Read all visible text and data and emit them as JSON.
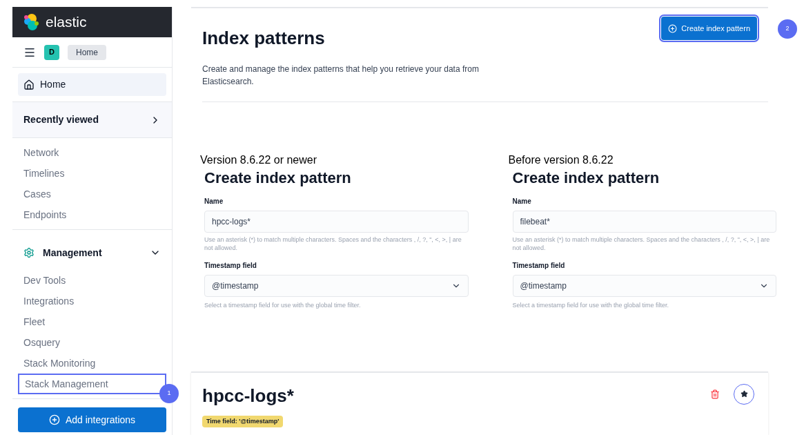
{
  "sidebar": {
    "logo": "elastic",
    "avatar": "D",
    "breadcrumb": "Home",
    "home": "Home",
    "recently_viewed": {
      "label": "Recently viewed",
      "expanded": false
    },
    "items": [
      {
        "label": "Network"
      },
      {
        "label": "Timelines"
      },
      {
        "label": "Cases"
      },
      {
        "label": "Endpoints"
      }
    ],
    "management": {
      "label": "Management",
      "expanded": true,
      "items": [
        {
          "label": "Dev Tools"
        },
        {
          "label": "Integrations"
        },
        {
          "label": "Fleet"
        },
        {
          "label": "Osquery"
        },
        {
          "label": "Stack Monitoring"
        },
        {
          "label": "Stack Management",
          "callout": "1"
        }
      ]
    },
    "add_button": "Add integrations"
  },
  "header": {
    "title": "Index patterns",
    "description": "Create and manage the index patterns that help you retrieve your data from Elasticsearch.",
    "create_button": {
      "label": "Create index pattern",
      "callout": "2"
    }
  },
  "versions": [
    {
      "caption": "Version 8.6.22 or newer",
      "title": "Create index pattern",
      "name_label": "Name",
      "name_value": "hpcc-logs*",
      "name_help": "Use an asterisk (*) to match multiple characters. Spaces and the characters , /, ?, \", <, >, | are not allowed.",
      "timestamp_label": "Timestamp field",
      "timestamp_value": "@timestamp",
      "timestamp_help": "Select a timestamp field for use with the global time filter."
    },
    {
      "caption": "Before version 8.6.22",
      "title": "Create index pattern",
      "name_label": "Name",
      "name_value": "filebeat*",
      "name_help": "Use an asterisk (*) to match multiple characters. Spaces and the characters , /, ?, \", <, >, | are not allowed.",
      "timestamp_label": "Timestamp field",
      "timestamp_value": "@timestamp",
      "timestamp_help": "Select a timestamp field for use with the global time filter."
    }
  ],
  "index": {
    "title": "hpcc-logs*",
    "badge": "Time field: '@timestamp'"
  }
}
